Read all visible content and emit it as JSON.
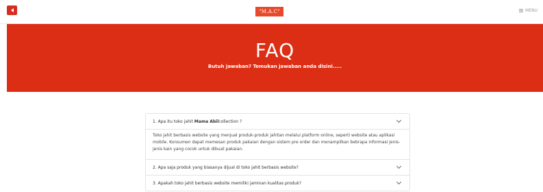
{
  "header": {
    "logo_text": "\"M.A.C\"",
    "menu_label": "MENU"
  },
  "hero": {
    "title": "FAQ",
    "subtitle": "Butuh jawaban? Temukan jawaban anda disini....."
  },
  "faq": {
    "items": [
      {
        "question_prefix": "1. Apa itu toko jahit ",
        "question_bold": "Mama Abil",
        "question_suffix": "collection ?",
        "expanded": true,
        "answer": "Toko jahit berbasis website yang menjual produk-produk jahitan melalui platform online, seperti website atau aplikasi mobile. Konsumen dapat memesan produk pakaian dengan sistem pre order dan menampilkan bebrapa informasi jenis-jenis kain yang cocok untuk dibuat pakaian."
      },
      {
        "question": "2. Apa saja produk yang biasanya dijual di toko jahit berbasis website?",
        "expanded": false
      },
      {
        "question": "3. Apakah toko jahit berbasis website memiliki jaminan kualitas produk?",
        "expanded": false
      }
    ]
  },
  "colors": {
    "accent": "#dc2e14",
    "logo_bg": "#e8492a"
  }
}
